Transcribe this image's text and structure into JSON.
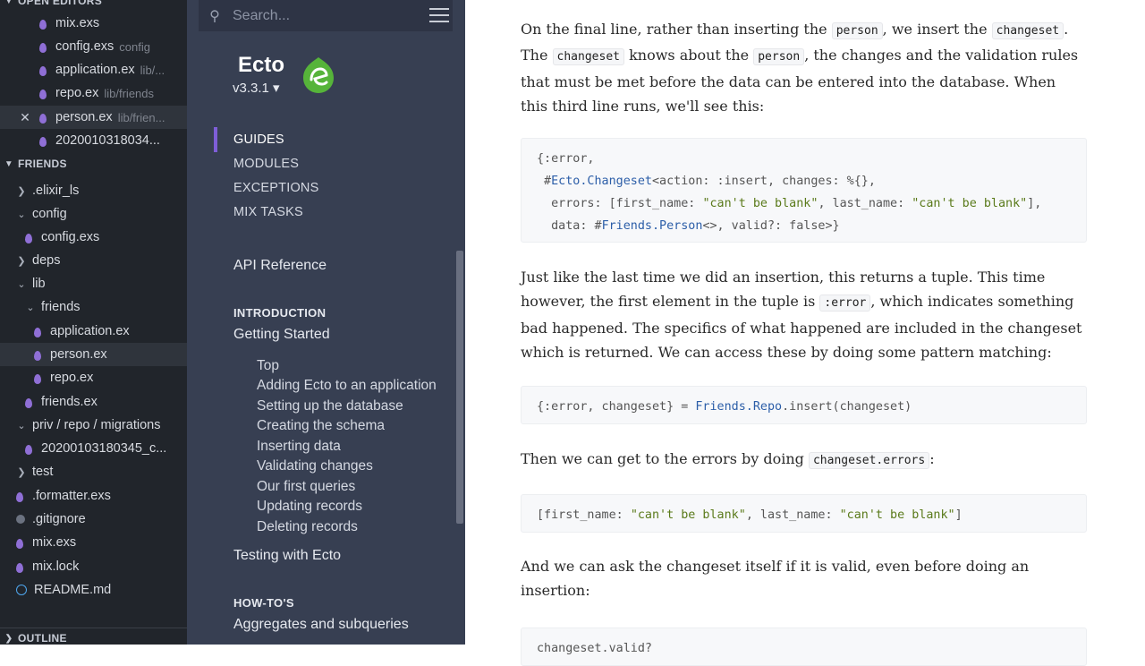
{
  "explorer": {
    "open_editors_title": "OPEN EDITORS",
    "open_editors": [
      {
        "name": "mix.exs",
        "desc": ""
      },
      {
        "name": "config.exs",
        "desc": "config"
      },
      {
        "name": "application.ex",
        "desc": "lib/..."
      },
      {
        "name": "repo.ex",
        "desc": "lib/friends"
      },
      {
        "name": "person.ex",
        "desc": "lib/frien..."
      },
      {
        "name": "2020010318034...",
        "desc": ""
      }
    ],
    "project_title": "FRIENDS",
    "tree": [
      {
        "name": ".elixir_ls"
      },
      {
        "name": "config"
      },
      {
        "name": "config.exs"
      },
      {
        "name": "deps"
      },
      {
        "name": "lib"
      },
      {
        "name": "friends"
      },
      {
        "name": "application.ex"
      },
      {
        "name": "person.ex"
      },
      {
        "name": "repo.ex"
      },
      {
        "name": "friends.ex"
      },
      {
        "name": "priv / repo / migrations"
      },
      {
        "name": "20200103180345_c..."
      },
      {
        "name": "test"
      },
      {
        "name": ".formatter.exs"
      },
      {
        "name": ".gitignore"
      },
      {
        "name": "mix.exs"
      },
      {
        "name": "mix.lock"
      },
      {
        "name": "README.md"
      }
    ],
    "outline_title": "OUTLINE"
  },
  "docs_sidebar": {
    "search_placeholder": "Search...",
    "project_name": "Ecto",
    "version": "v3.3.1 ▾",
    "tabs": [
      "GUIDES",
      "MODULES",
      "EXCEPTIONS",
      "MIX TASKS"
    ],
    "api_reference": "API Reference",
    "intro_heading": "INTRODUCTION",
    "getting_started": "Getting Started",
    "sub_links": [
      "Top",
      "Adding Ecto to an application",
      "Setting up the database",
      "Creating the schema",
      "Inserting data",
      "Validating changes",
      "Our first queries",
      "Updating records",
      "Deleting records"
    ],
    "testing_with_ecto": "Testing with Ecto",
    "howtos_heading": "HOW-TO'S",
    "aggregates": "Aggregates and subqueries"
  },
  "content": {
    "p1": {
      "a": "On the final line, rather than inserting the ",
      "c1": "person",
      "b": ", we insert the ",
      "c2": "changeset",
      "c": ". The ",
      "c3": "changeset",
      "d": " knows about the ",
      "c4": "person",
      "e": ", the changes and the validation rules that must be met before the data can be entered into the database. When this third line runs, we'll see this:"
    },
    "code1": {
      "l1": "{:error,",
      "l2a": " #",
      "l2b": "Ecto.Changeset",
      "l2c": "<action: :insert, changes: %{},",
      "l3a": "  errors: [first_name: ",
      "l3b": "\"can't be blank\"",
      "l3c": ", last_name: ",
      "l3d": "\"can't be blank\"",
      "l3e": "],",
      "l4a": "  data: #",
      "l4b": "Friends.Person",
      "l4c": "<>, valid?: false>}"
    },
    "p2": {
      "a": "Just like the last time we did an insertion, this returns a tuple. This time however, the first element in the tuple is ",
      "c1": ":error",
      "b": ", which indicates something bad happened. The specifics of what happened are included in the changeset which is returned. We can access these by doing some pattern matching:"
    },
    "code2": {
      "a": "{:error, changeset} = ",
      "b": "Friends.Repo",
      "c": ".insert(changeset)"
    },
    "p3": {
      "a": "Then we can get to the errors by doing ",
      "c1": "changeset.errors",
      "b": ":"
    },
    "code3": {
      "a": "[first_name: ",
      "b": "\"can't be blank\"",
      "c": ", last_name: ",
      "d": "\"can't be blank\"",
      "e": "]"
    },
    "p4": {
      "a": "And we can ask the changeset itself if it is valid, even before doing an insertion:"
    },
    "code4": {
      "a": "changeset.valid?"
    }
  }
}
